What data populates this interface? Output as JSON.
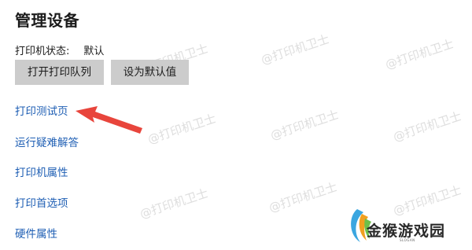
{
  "section": {
    "title": "管理设备"
  },
  "status": {
    "label": "打印机状态:",
    "value": "默认"
  },
  "buttons": {
    "open_queue": "打开打印队列",
    "set_default": "设为默认值"
  },
  "links": {
    "test_page": "打印测试页",
    "troubleshooter": "运行疑难解答",
    "printer_properties": "打印机属性",
    "printing_preferences": "打印首选项",
    "hardware_properties": "硬件属性"
  },
  "watermark": {
    "text": "@打印机卫士"
  },
  "logo": {
    "text": "金猴游戏园",
    "subtext": "SLOGAN"
  },
  "colors": {
    "link": "#1f5fb4",
    "button_bg": "#cccccc",
    "arrow": "#e8453c"
  }
}
